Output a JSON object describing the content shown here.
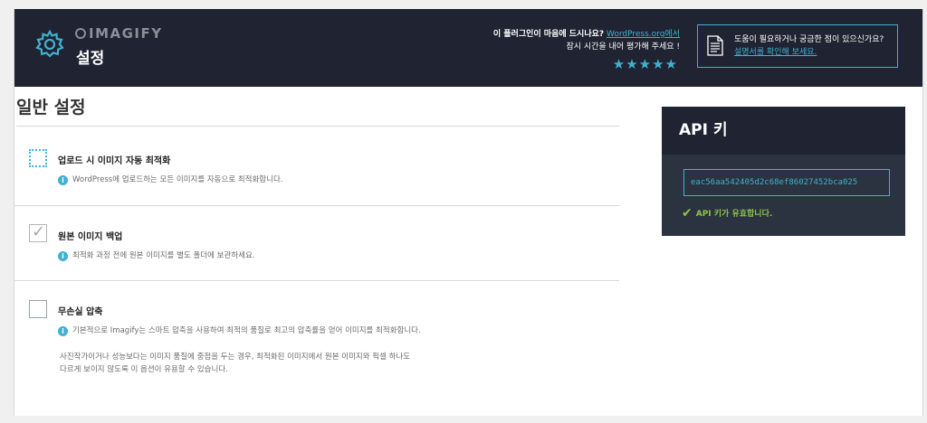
{
  "header": {
    "logo_text": "IMAGIFY",
    "title": "설정",
    "rate_question": "이 플러그인이 마음에 드시나요?",
    "rate_link": "WordPress.org에서",
    "rate_line2": "잠시 시간을 내어 평가해 주세요 !",
    "stars": "★★★★★",
    "help_text": "도움이 필요하거나 궁금한 점이 있으신가요?",
    "help_link": "설명서를 확인해 보세요."
  },
  "main": {
    "section_title": "일반 설정",
    "options": [
      {
        "label": "업로드 시 이미지 자동 최적화",
        "description": "WordPress에 업로드하는 모든 이미지를 자동으로 최적화합니다.",
        "checked": false
      },
      {
        "label": "원본 이미지 백업",
        "description": "최적화 과정 전에 원본 이미지를 별도 폴더에 보관하세요.",
        "checked": true
      },
      {
        "label": "무손실 압축",
        "description": "기본적으로 Imagify는 스마트 압축을 사용하여 최적의 품질로 최고의 압축률을 얻어 이미지를 최적화합니다.",
        "checked": false,
        "extra_line1": "사진작가이거나 성능보다는 이미지 품질에 중점을 두는 경우, 최적화된 이미지에서 원본 이미지와 픽셀 하나도",
        "extra_line2": "다르게 보이지 않도록 이 옵션이 유용할 수 있습니다."
      }
    ]
  },
  "api": {
    "title": "API 키",
    "key": "eac56aa542405d2c68ef86027452bca025",
    "status": "API 키가 유효합니다."
  },
  "colors": {
    "accent": "#40b1d0",
    "header_bg": "#1f2332",
    "success": "#8bc34a"
  }
}
